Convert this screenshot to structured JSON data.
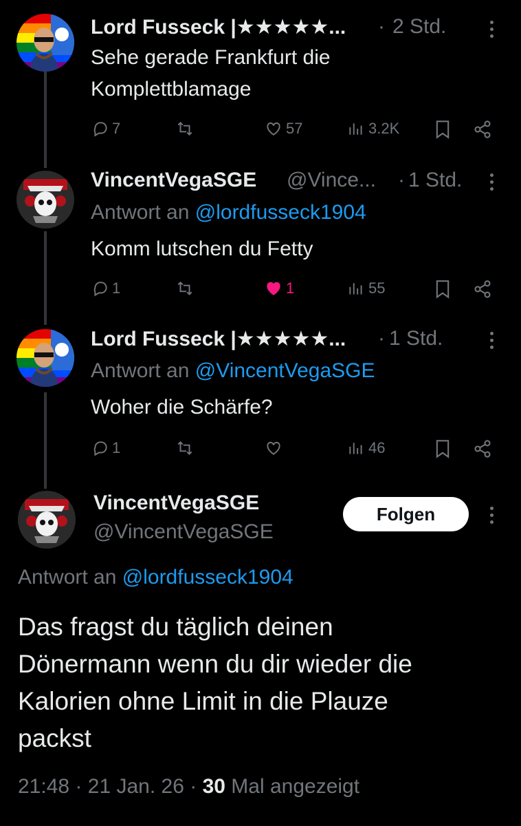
{
  "tweets": [
    {
      "name": "Lord Fusseck |★★★★★...",
      "sep": "·",
      "time": "2 Std.",
      "text_lines": [
        "Sehe gerade Frankfurt die",
        "Komplettblamage"
      ],
      "replies": "7",
      "likes": "57",
      "views": "3.2K"
    },
    {
      "name": "VincentVegaSGE",
      "handle": "@Vince...",
      "sep": "·",
      "time": "1 Std.",
      "reply_prefix": "Antwort an",
      "reply_to": "@lordfusseck1904",
      "text_lines": [
        "Komm lutschen du Fetty"
      ],
      "replies": "1",
      "likes": "1",
      "views": "55"
    },
    {
      "name": "Lord Fusseck |★★★★★...",
      "sep": "·",
      "time": "1 Std.",
      "reply_prefix": "Antwort an",
      "reply_to": "@VincentVegaSGE",
      "text_lines": [
        "Woher die Schärfe?"
      ],
      "replies": "1",
      "views": "46"
    }
  ],
  "main": {
    "name": "VincentVegaSGE",
    "handle": "@VincentVegaSGE",
    "follow_label": "Folgen",
    "reply_prefix": "Antwort an",
    "reply_to": "@lordfusseck1904",
    "text_lines": [
      "Das fragst du täglich deinen",
      "Dönermann wenn du dir wieder die",
      "Kalorien ohne Limit in die Plauze",
      "packst"
    ],
    "time": "21:48",
    "sep1": "·",
    "date": "21 Jan. 26",
    "sep2": "·",
    "views_count": "30",
    "views_label": "Mal angezeigt"
  },
  "colors": {
    "background": "#000000",
    "text": "#e7e9ea",
    "muted": "#71767b",
    "link": "#1d9bf0",
    "like_active": "#f91880"
  },
  "icons": [
    "reply-icon",
    "retweet-icon",
    "like-icon",
    "views-icon",
    "bookmark-icon",
    "share-icon",
    "more-icon"
  ]
}
